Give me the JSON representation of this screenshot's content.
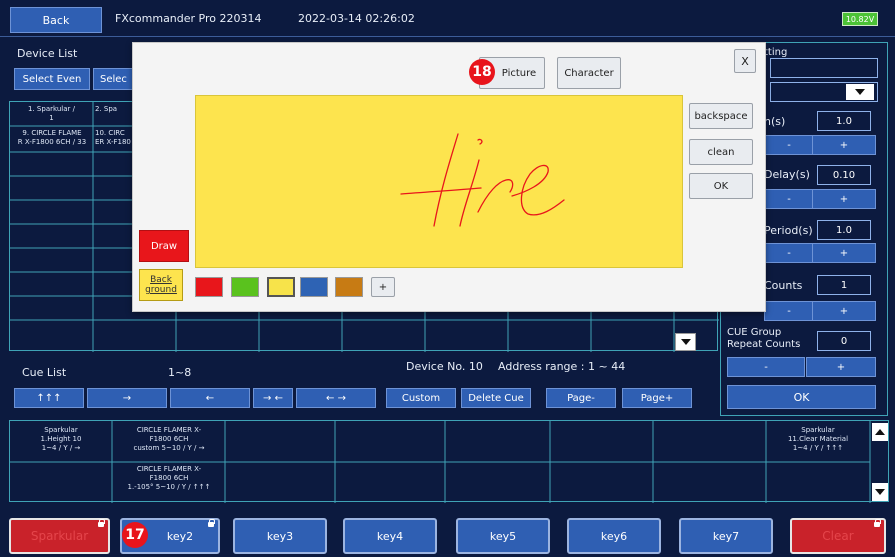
{
  "header": {
    "back": "Back",
    "app_title": "FXcommander Pro 220314",
    "datetime": "2022-03-14 02:26:02",
    "battery": "10.82V"
  },
  "device_list": {
    "title": "Device List",
    "select_even": "Select Even",
    "select_partial": "Selec",
    "cells": [
      [
        "1. Sparkular /",
        "1"
      ],
      [
        "2. Spa",
        ""
      ]
    ],
    "cells2": [
      [
        "9. CIRCLE FLAME",
        "R X-F1800 6CH / 33"
      ],
      [
        "10. CIRC",
        "ER X-F180"
      ]
    ]
  },
  "right_panel": {
    "setting_label": "tting",
    "duration_label": "n(s)",
    "duration_value": "1.0",
    "delay_label": "Delay(s)",
    "delay_value": "0.10",
    "period_label": "Period(s)",
    "period_value": "1.0",
    "counts_label": "Counts",
    "counts_value": "1",
    "group_label_1": "CUE Group",
    "group_label_2": "Repeat Counts",
    "group_value": "0",
    "minus": "-",
    "plus": "+",
    "ok": "OK"
  },
  "cue_list": {
    "title": "Cue List",
    "range": "1~8",
    "device_no": "Device No. 10",
    "address_range": "Address range : 1 ~ 44",
    "arrows": [
      "↑↑↑",
      "→",
      "←",
      "→ ←",
      "← →"
    ],
    "custom": "Custom",
    "delete_cue": "Delete Cue",
    "page_minus": "Page-",
    "page_plus": "Page+"
  },
  "cue_table": {
    "c1": [
      "Sparkular",
      "1.Height 10",
      "1~4 / Y / →"
    ],
    "c2": [
      "CIRCLE FLAMER X-",
      "F1800 6CH",
      "custom 5~10 / Y / →"
    ],
    "c3": [
      "CIRCLE FLAMER X-",
      "F1800 6CH",
      "1.-105° 5~10 / Y / ↑↑↑"
    ],
    "c_last": [
      "Sparkular",
      "11.Clear Material",
      "1~4 / Y / ↑↑↑"
    ]
  },
  "keys": {
    "k1": "Sparkular",
    "k2": "key2",
    "k3": "key3",
    "k4": "key4",
    "k5": "key5",
    "k6": "key6",
    "k7": "key7",
    "k8": "Clear"
  },
  "dialog": {
    "close": "X",
    "picture": "Picture",
    "character": "Character",
    "backspace": "backspace",
    "clean": "clean",
    "ok": "OK",
    "draw": "Draw",
    "background_1": "Back",
    "background_2": "ground",
    "add": "+",
    "handwriting": "fire",
    "swatches": [
      "#e8161b",
      "#5ac21e",
      "#f7e34a",
      "#2e63b4",
      "#c77b14"
    ]
  },
  "badges": {
    "b17": "17",
    "b18": "18"
  },
  "colors": {
    "accent": "#2f5fb3",
    "canvas": "#fde44e",
    "stroke": "#e8161b"
  }
}
